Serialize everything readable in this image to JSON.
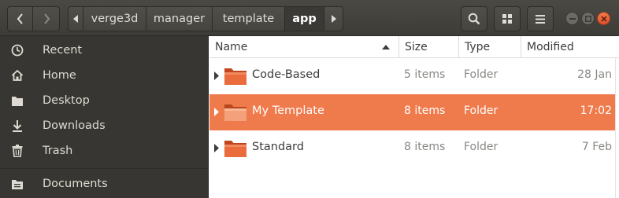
{
  "breadcrumbs": [
    {
      "label": "verge3d"
    },
    {
      "label": "manager"
    },
    {
      "label": "template"
    },
    {
      "label": "app",
      "current": true
    }
  ],
  "icons": {
    "back": "chevron-left-icon",
    "forward": "chevron-right-icon",
    "search": "search-icon",
    "view": "grid-view-icon",
    "menu": "hamburger-menu-icon",
    "minimize": "minimize-icon",
    "maximize": "maximize-icon",
    "close": "close-icon"
  },
  "sidebar": {
    "items": [
      {
        "label": "Recent",
        "icon": "clock-icon"
      },
      {
        "label": "Home",
        "icon": "home-icon"
      },
      {
        "label": "Desktop",
        "icon": "desktop-folder-icon"
      },
      {
        "label": "Downloads",
        "icon": "download-icon"
      },
      {
        "label": "Trash",
        "icon": "trash-icon"
      },
      {
        "label": "Documents",
        "icon": "documents-icon"
      }
    ]
  },
  "columns": {
    "name": "Name",
    "size": "Size",
    "type": "Type",
    "modified": "Modified",
    "sort": "ascending"
  },
  "files": [
    {
      "name": "Code-Based",
      "size": "5 items",
      "type": "Folder",
      "modified": "28 Jan",
      "selected": false
    },
    {
      "name": "My Template",
      "size": "8 items",
      "type": "Folder",
      "modified": "17:02",
      "selected": true
    },
    {
      "name": "Standard",
      "size": "8 items",
      "type": "Folder",
      "modified": "7 Feb",
      "selected": false
    }
  ],
  "colors": {
    "accent": "#ef7a4b",
    "sidebar_bg": "#373632",
    "header_bg": "#44433e",
    "folder": "#e8663a"
  }
}
